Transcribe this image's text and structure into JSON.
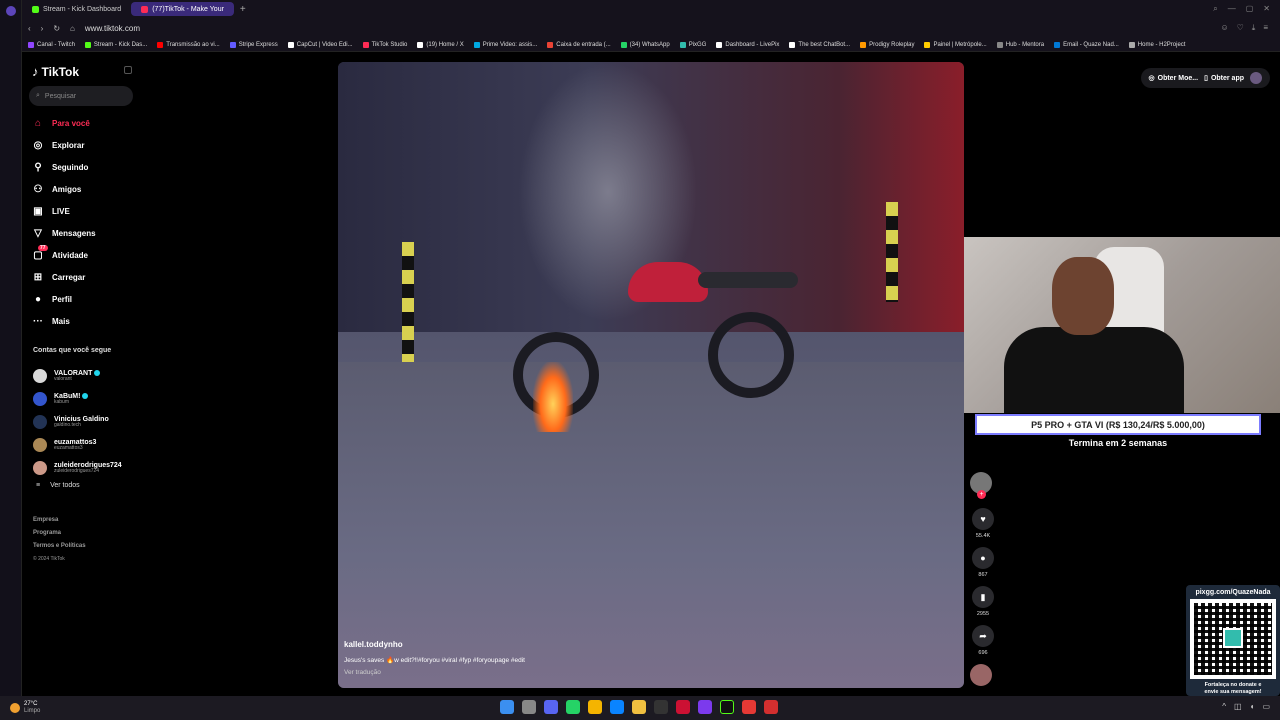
{
  "browser": {
    "tabs": [
      {
        "label": "Stream - Kick Dashboard",
        "color": "#53fc18",
        "active": false
      },
      {
        "label": "(77)TikTok - Make Your",
        "color": "#fe2c55",
        "active": true
      }
    ],
    "url": "www.tiktok.com"
  },
  "bookmarks": [
    {
      "label": "Canal - Twitch",
      "color": "#9146ff"
    },
    {
      "label": "Stream - Kick Das...",
      "color": "#53fc18"
    },
    {
      "label": "Transmissão ao vi...",
      "color": "#ff0000"
    },
    {
      "label": "Stripe Express",
      "color": "#635bff"
    },
    {
      "label": "CapCut | Video Edi...",
      "color": "#ffffff"
    },
    {
      "label": "TikTok Studio",
      "color": "#fe2c55"
    },
    {
      "label": "(19) Home / X",
      "color": "#ffffff"
    },
    {
      "label": "Prime Video: assis...",
      "color": "#00a8e1"
    },
    {
      "label": "Caixa de entrada (...",
      "color": "#ea4335"
    },
    {
      "label": "(34) WhatsApp",
      "color": "#25d366"
    },
    {
      "label": "PixGG",
      "color": "#32bcad"
    },
    {
      "label": "Dashboard - LivePix",
      "color": "#ffffff"
    },
    {
      "label": "The best ChatBot...",
      "color": "#ffffff"
    },
    {
      "label": "Prodigy Roleplay",
      "color": "#ff9900"
    },
    {
      "label": "Painel | Metrópole...",
      "color": "#ffcc00"
    },
    {
      "label": "Hub - Mentora",
      "color": "#888888"
    },
    {
      "label": "Email - Quaze Nad...",
      "color": "#0078d4"
    },
    {
      "label": "Home - H2Project",
      "color": "#aaaaaa"
    }
  ],
  "tiktok": {
    "logo": "TikTok",
    "search_placeholder": "Pesquisar",
    "nav": [
      {
        "label": "Para você",
        "icon": "home-icon",
        "glyph": "⌂",
        "active": true
      },
      {
        "label": "Explorar",
        "icon": "compass-icon",
        "glyph": "◎",
        "active": false
      },
      {
        "label": "Seguindo",
        "icon": "following-icon",
        "glyph": "⚲",
        "active": false
      },
      {
        "label": "Amigos",
        "icon": "friends-icon",
        "glyph": "⚇",
        "active": false
      },
      {
        "label": "LIVE",
        "icon": "live-icon",
        "glyph": "▣",
        "active": false
      },
      {
        "label": "Mensagens",
        "icon": "messages-icon",
        "glyph": "▽",
        "active": false
      },
      {
        "label": "Atividade",
        "icon": "activity-icon",
        "glyph": "▢",
        "active": false,
        "badge": "77"
      },
      {
        "label": "Carregar",
        "icon": "upload-icon",
        "glyph": "⊞",
        "active": false
      },
      {
        "label": "Perfil",
        "icon": "profile-icon",
        "glyph": "●",
        "active": false
      },
      {
        "label": "Mais",
        "icon": "more-icon",
        "glyph": "···",
        "active": false
      }
    ],
    "following_title": "Contas que você segue",
    "accounts": [
      {
        "name": "VALORANT",
        "handle": "valorant",
        "verified": true,
        "color": "#d9d9d9"
      },
      {
        "name": "KaBuM!",
        "handle": "kabum",
        "verified": true,
        "color": "#3355cc"
      },
      {
        "name": "Vinicius Galdino",
        "handle": "galdino.tech",
        "verified": false,
        "color": "#223355"
      },
      {
        "name": "euzamattos3",
        "handle": "euzamattos3",
        "verified": false,
        "color": "#aa8855"
      },
      {
        "name": "zuleiderodrigues724",
        "handle": "zuleiderodrigues724",
        "verified": false,
        "color": "#cc9988"
      }
    ],
    "see_all": "Ver todos",
    "footer": [
      "Empresa",
      "Programa",
      "Termos e Políticas"
    ],
    "copyright": "© 2024 TikTok",
    "top_buttons": {
      "coins": "Obter Moe...",
      "app": "Obter app"
    },
    "video": {
      "username": "kallel.toddynho",
      "description": "Jesus's saves 🔥w edit?‼#foryou #viral #fyp #foryoupage #edit",
      "translate": "Ver tradução"
    },
    "actions": {
      "likes": "55.4K",
      "comments": "867",
      "saves": "2955",
      "shares": "696"
    }
  },
  "overlay": {
    "goal": "P5 PRO + GTA VI (R$ 130,24/R$ 5.000,00)",
    "goal_sub": "Termina em 2 semanas",
    "qr_title": "pixgg.com/QuazeNada",
    "qr_caption_1": "Fortaleça no donate e",
    "qr_caption_2": "envie sua mensagem!"
  },
  "taskbar": {
    "temp": "27°C",
    "weather": "Limpo"
  }
}
